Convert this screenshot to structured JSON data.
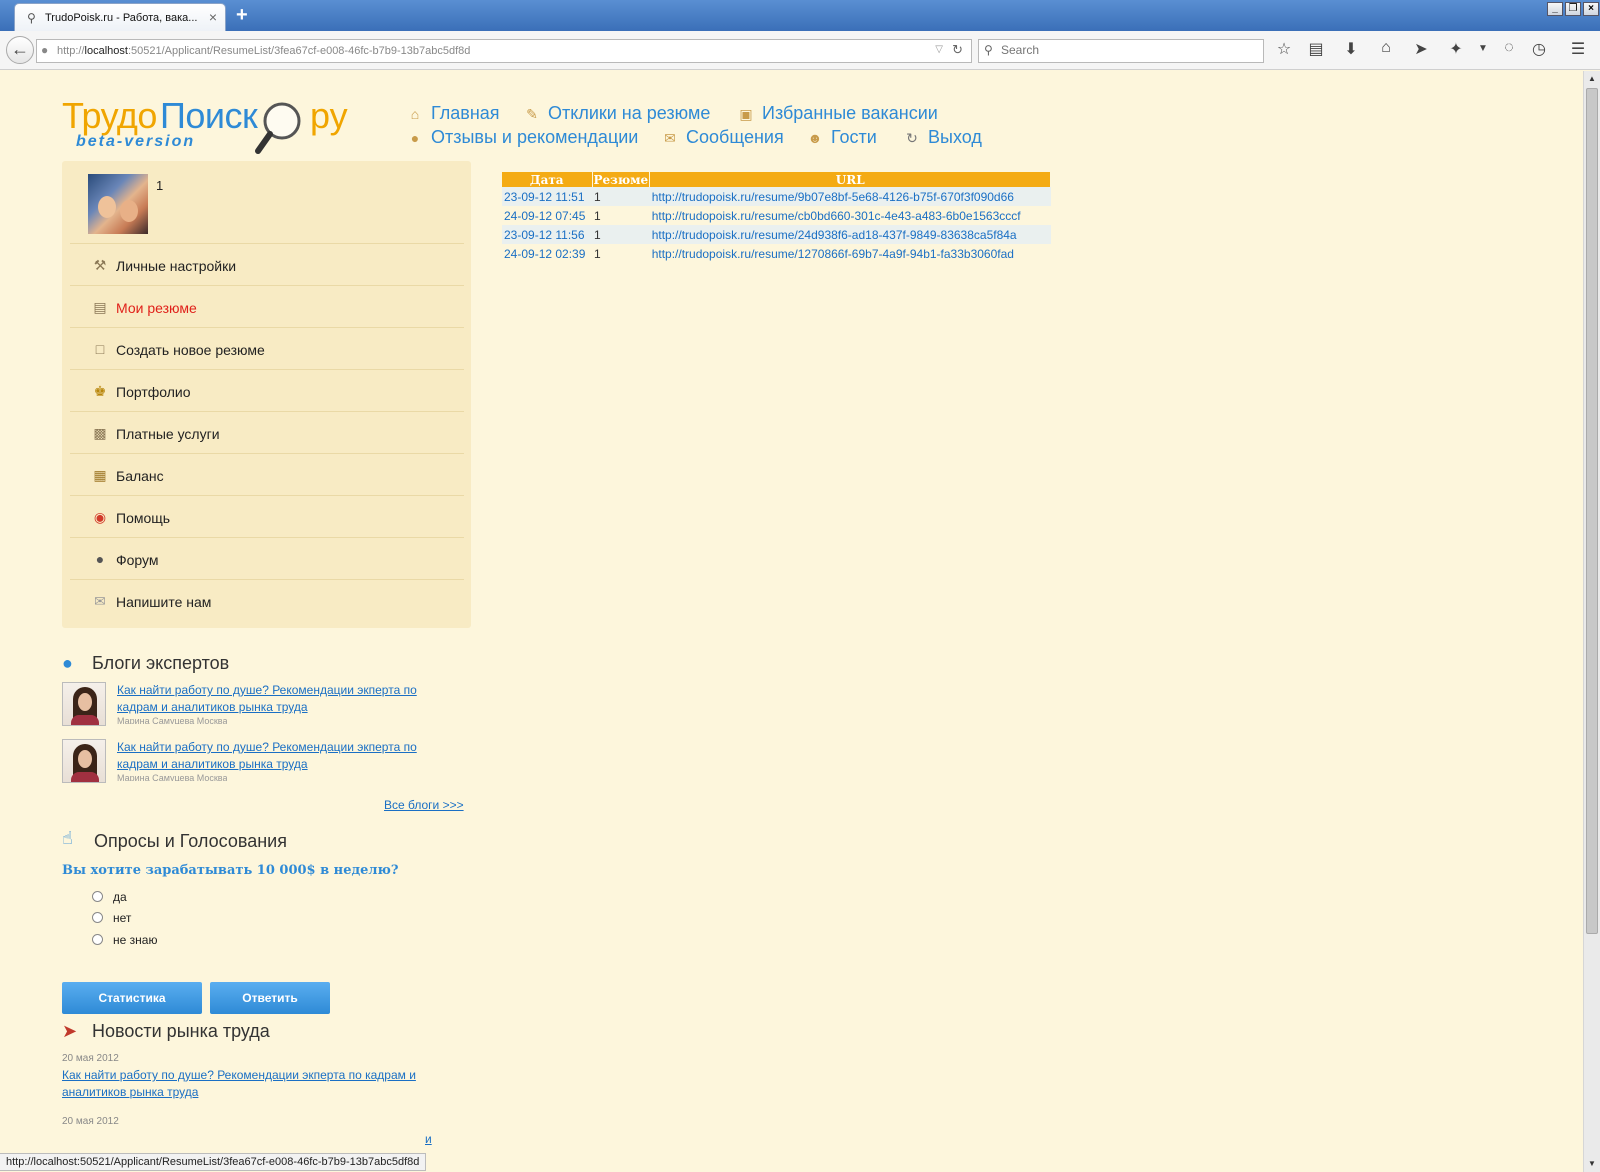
{
  "browser": {
    "tab_title": "TrudoPoisk.ru - Работа, вака...",
    "url_prefix": "http://",
    "url_host": "localhost",
    "url_rest": ":50521/Applicant/ResumeList/3fea67cf-e008-46fc-b7b9-13b7abc5df8d",
    "search_placeholder": "Search",
    "status_url": "http://localhost:50521/Applicant/ResumeList/3fea67cf-e008-46fc-b7b9-13b7abc5df8d"
  },
  "logo": {
    "part1": "Трудо",
    "part2": "Поиск",
    "part3": "ру",
    "beta": "beta-version"
  },
  "nav": [
    {
      "label": "Главная",
      "icon": "home-icon"
    },
    {
      "label": "Отклики на резюме",
      "icon": "responses-icon"
    },
    {
      "label": "Избранные вакансии",
      "icon": "briefcase-icon"
    },
    {
      "label": "Отзывы и рекомендации",
      "icon": "reviews-icon"
    },
    {
      "label": "Сообщения",
      "icon": "envelope-icon"
    },
    {
      "label": "Гости",
      "icon": "guests-icon"
    },
    {
      "label": "Выход",
      "icon": "logout-icon"
    }
  ],
  "user": {
    "name": "1"
  },
  "sidebar": {
    "items": [
      {
        "label": "Личные настройки",
        "icon": "tools-icon"
      },
      {
        "label": "Мои резюме",
        "icon": "resume-icon",
        "active": true
      },
      {
        "label": "Создать новое резюме",
        "icon": "new-resume-icon"
      },
      {
        "label": "Портфолио",
        "icon": "trophy-icon"
      },
      {
        "label": "Платные услуги",
        "icon": "money-icon"
      },
      {
        "label": "Баланс",
        "icon": "wallet-icon"
      },
      {
        "label": "Помощь",
        "icon": "lifebuoy-icon"
      },
      {
        "label": "Форум",
        "icon": "forum-icon"
      },
      {
        "label": "Напишите нам",
        "icon": "mail-icon"
      }
    ]
  },
  "blogs": {
    "title": "Блоги экспертов",
    "items": [
      {
        "link": "Как найти работу по душе? Рекомендации экперта по кадрам и аналитиков рынка труда",
        "author": "Марина Самуцева Москва"
      },
      {
        "link": "Как найти работу по душе? Рекомендации экперта по кадрам и аналитиков рынка труда",
        "author": "Марина Самуцева Москва"
      }
    ],
    "all_link": "Все блоги >>>"
  },
  "poll": {
    "title": "Опросы и Голосования",
    "question": "Вы хотите зарабатывать 10 000$ в неделю?",
    "options": [
      "да",
      "нет",
      "не знаю"
    ],
    "stats_button": "Статистика",
    "answer_button": "Ответить"
  },
  "news": {
    "title": "Новости рынка труда",
    "items": [
      {
        "date": "20 мая 2012",
        "link": "Как найти работу по душе? Рекомендации экперта по кадрам и аналитиков рынка труда"
      },
      {
        "date": "20 мая 2012",
        "link": "и"
      }
    ]
  },
  "responses_table": {
    "headers": [
      "Дата",
      "Резюме",
      "URL"
    ],
    "rows": [
      {
        "date": "23-09-12 11:51",
        "resume": "1",
        "url": "http://trudopoisk.ru/resume/9b07e8bf-5e68-4126-b75f-670f3f090d66"
      },
      {
        "date": "24-09-12 07:45",
        "resume": "1",
        "url": "http://trudopoisk.ru/resume/cb0bd660-301c-4e43-a483-6b0e1563cccf"
      },
      {
        "date": "23-09-12 11:56",
        "resume": "1",
        "url": "http://trudopoisk.ru/resume/24d938f6-ad18-437f-9849-83638ca5f84a"
      },
      {
        "date": "24-09-12 02:39",
        "resume": "1",
        "url": "http://trudopoisk.ru/resume/1270866f-69b7-4a9f-94b1-fa33b3060fad"
      }
    ]
  },
  "colors": {
    "page_bg": "#fdf6dc",
    "sidebar_bg": "#f8ebc4",
    "link": "#1a6fc4",
    "accent_orange": "#f4ab14",
    "active_red": "#e0211a",
    "button_blue": "#2e8ad6"
  }
}
